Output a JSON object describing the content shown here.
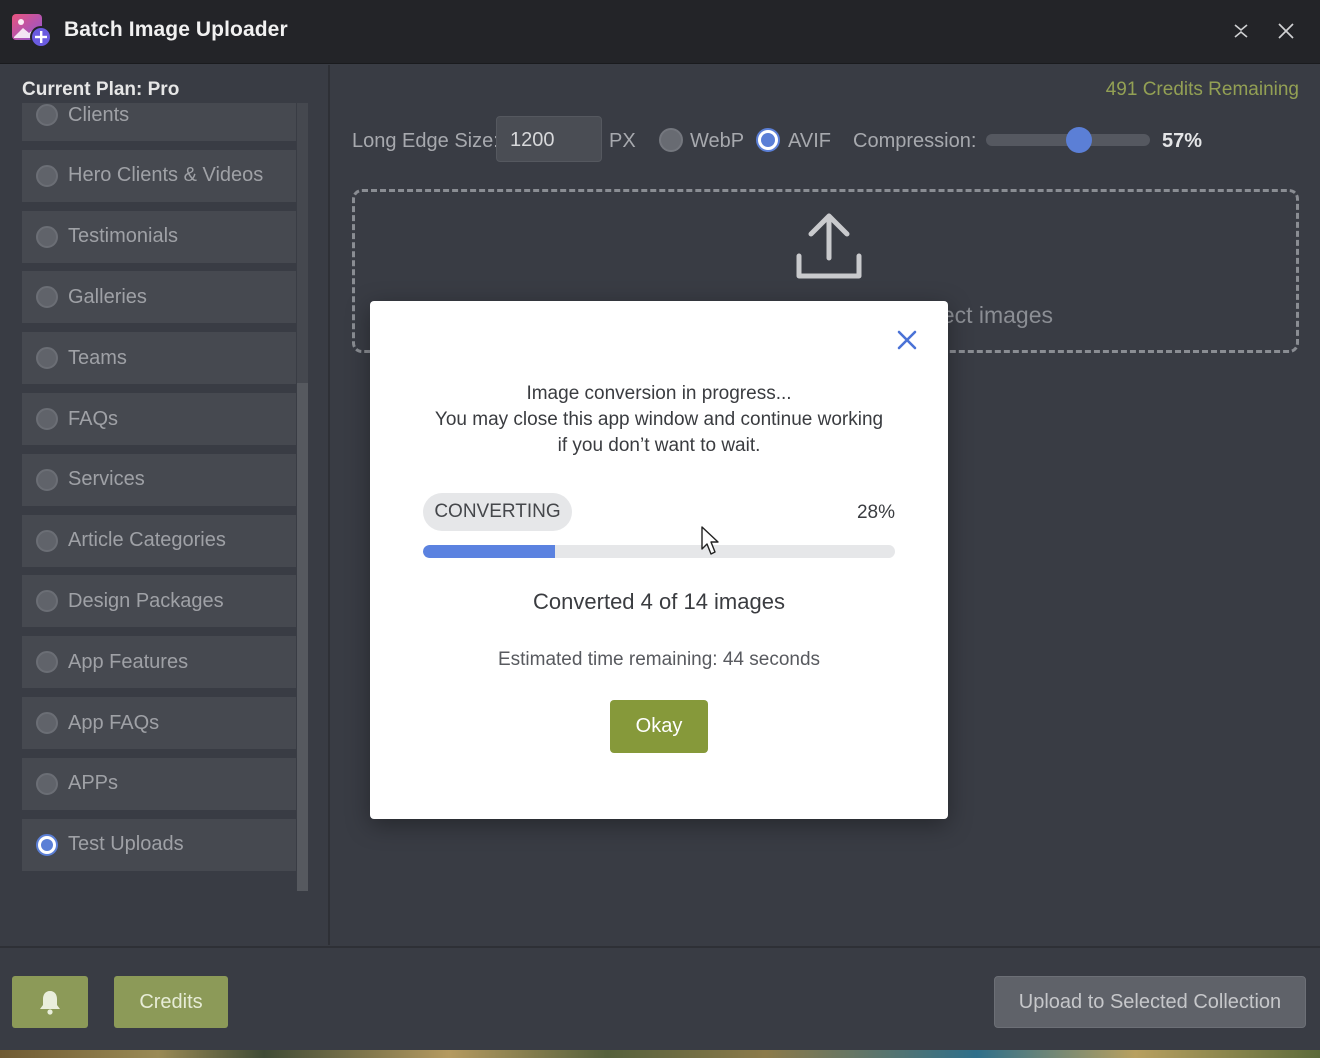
{
  "app": {
    "title": "Batch Image Uploader",
    "icon": "image-add-icon"
  },
  "sidebar": {
    "plan_label": "Current Plan: Pro",
    "items": [
      {
        "label": "Clients",
        "selected": false
      },
      {
        "label": "Hero Clients & Videos",
        "selected": false
      },
      {
        "label": "Testimonials",
        "selected": false
      },
      {
        "label": "Galleries",
        "selected": false
      },
      {
        "label": "Teams",
        "selected": false
      },
      {
        "label": "FAQs",
        "selected": false
      },
      {
        "label": "Services",
        "selected": false
      },
      {
        "label": "Article Categories",
        "selected": false
      },
      {
        "label": "Design Packages",
        "selected": false
      },
      {
        "label": "App Features",
        "selected": false
      },
      {
        "label": "App FAQs",
        "selected": false
      },
      {
        "label": "APPs",
        "selected": false
      },
      {
        "label": "Test Uploads",
        "selected": true
      }
    ]
  },
  "main": {
    "credits_remaining": "491 Credits Remaining",
    "long_edge_label": "Long Edge Size:",
    "long_edge_value": "1200",
    "unit": "PX",
    "formats": [
      {
        "label": "WebP",
        "selected": false
      },
      {
        "label": "AVIF",
        "selected": true
      }
    ],
    "compression_label": "Compression:",
    "compression_value": "57%",
    "compression_fraction": 0.57,
    "dropzone_text": "select images"
  },
  "modal": {
    "line1": "Image conversion in progress...",
    "line2": "You may close this app window and continue working",
    "line3": "if you don’t want to wait.",
    "status_badge": "CONVERTING",
    "progress_label": "28%",
    "progress_fraction": 0.28,
    "converted_text": "Converted 4 of 14 images",
    "eta_text": "Estimated time remaining: 44 seconds",
    "okay_label": "Okay"
  },
  "bottom": {
    "credits_label": "Credits",
    "upload_label": "Upload to Selected Collection"
  },
  "colors": {
    "accent_blue": "#5b7fd6",
    "olive_button": "#8c9a58",
    "okay_green": "#86993a",
    "credits_text": "#93a054"
  }
}
